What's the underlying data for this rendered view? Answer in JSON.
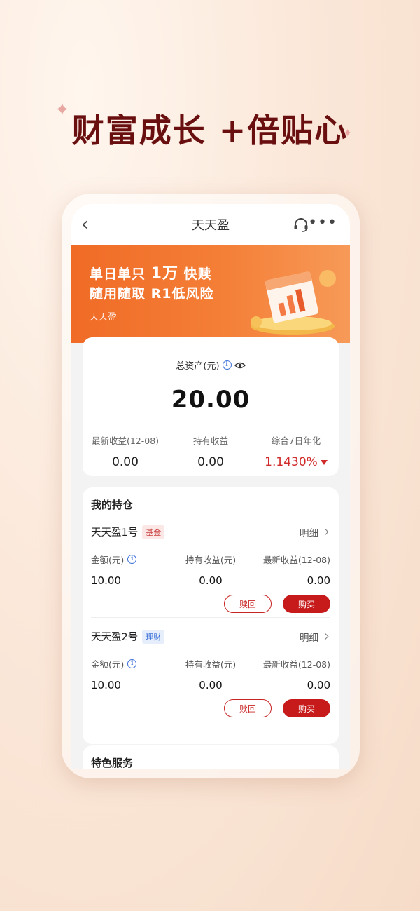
{
  "headline": "财富成长 +倍贴心",
  "nav": {
    "title": "天天盈"
  },
  "banner": {
    "line1_a": "单日单只",
    "line1_b": "1万",
    "line1_c": "快赎",
    "line2": "随用随取 R1低风险",
    "sub": "天天盈"
  },
  "assets": {
    "label": "总资产(元)",
    "value": "20.00",
    "stats": [
      {
        "label": "最新收益(12-08)",
        "value": "0.00"
      },
      {
        "label": "持有收益",
        "value": "0.00"
      },
      {
        "label": "综合7日年化",
        "value": "1.1430%"
      }
    ]
  },
  "holdings": {
    "title": "我的持仓",
    "items": [
      {
        "name": "天天盈1号",
        "tag": "基金",
        "detail": "明细",
        "amount_label": "金额(元)",
        "amount": "10.00",
        "hold_label": "持有收益(元)",
        "hold": "0.00",
        "latest_label": "最新收益(12-08)",
        "latest": "0.00",
        "redeem": "赎回",
        "buy": "购买"
      },
      {
        "name": "天天盈2号",
        "tag": "理财",
        "detail": "明细",
        "amount_label": "金额(元)",
        "amount": "10.00",
        "hold_label": "持有收益(元)",
        "hold": "0.00",
        "latest_label": "最新收益(12-08)",
        "latest": "0.00",
        "redeem": "赎回",
        "buy": "购买"
      }
    ]
  },
  "services": {
    "title": "特色服务"
  },
  "colors": {
    "accent": "#c71a1a",
    "banner": "#f06b26",
    "headline": "#6a0f10"
  }
}
